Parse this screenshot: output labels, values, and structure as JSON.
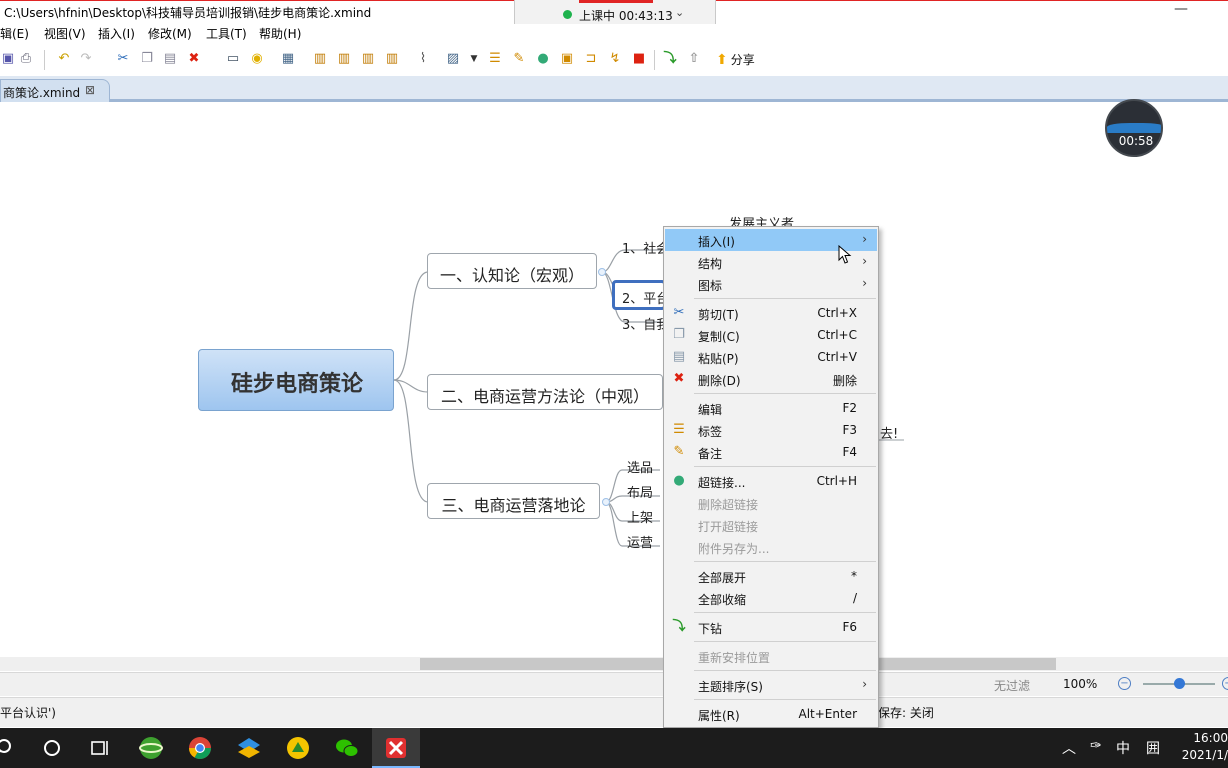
{
  "window": {
    "path": "C:\\Users\\hfnin\\Desktop\\科技辅导员培训报销\\硅步电商策论.xmind",
    "minimize_glyph": "—"
  },
  "class_timer": {
    "label": "上课中 00:43:13",
    "chevron": "⌄"
  },
  "menubar": {
    "items": [
      "辑(E)",
      "视图(V)",
      "插入(I)",
      "修改(M)",
      "工具(T)",
      "帮助(H)"
    ]
  },
  "toolbar": {
    "share_label": "分享"
  },
  "tab": {
    "label": "商策论.xmind",
    "close": "⊠"
  },
  "recording_timer": "00:58",
  "mindmap": {
    "central": "硅步电商策论",
    "topics": [
      "一、认知论（宏观）",
      "二、电商运营方法论（中观）",
      "三、电商运营落地论"
    ],
    "subtopics_1": [
      "1、社会",
      "2、平台",
      "3、自我"
    ],
    "subtopics_3": [
      "选品",
      "布局",
      "上架",
      "运营"
    ],
    "float_text_1": "发展主义者",
    "float_text_2": "去!"
  },
  "context_menu": {
    "items": [
      {
        "label": "插入(I)",
        "shortcut": "",
        "submenu": true,
        "icon": "",
        "active": true,
        "disabled": false
      },
      {
        "label": "结构",
        "shortcut": "",
        "submenu": true,
        "icon": "",
        "active": false,
        "disabled": false
      },
      {
        "label": "图标",
        "shortcut": "",
        "submenu": true,
        "icon": "",
        "active": false,
        "disabled": false
      },
      {
        "label": "剪切(T)",
        "shortcut": "Ctrl+X",
        "submenu": false,
        "icon": "scissors-icon",
        "active": false,
        "disabled": false
      },
      {
        "label": "复制(C)",
        "shortcut": "Ctrl+C",
        "submenu": false,
        "icon": "copy-icon",
        "active": false,
        "disabled": false
      },
      {
        "label": "粘贴(P)",
        "shortcut": "Ctrl+V",
        "submenu": false,
        "icon": "paste-icon",
        "active": false,
        "disabled": false
      },
      {
        "label": "删除(D)",
        "shortcut": "删除",
        "submenu": false,
        "icon": "delete-icon",
        "active": false,
        "disabled": false
      },
      {
        "label": "编辑",
        "shortcut": "F2",
        "submenu": false,
        "icon": "",
        "active": false,
        "disabled": false
      },
      {
        "label": "标签",
        "shortcut": "F3",
        "submenu": false,
        "icon": "label-icon",
        "active": false,
        "disabled": false
      },
      {
        "label": "备注",
        "shortcut": "F4",
        "submenu": false,
        "icon": "note-icon",
        "active": false,
        "disabled": false
      },
      {
        "label": "超链接...",
        "shortcut": "Ctrl+H",
        "submenu": false,
        "icon": "globe-icon",
        "active": false,
        "disabled": false
      },
      {
        "label": "删除超链接",
        "shortcut": "",
        "submenu": false,
        "icon": "",
        "active": false,
        "disabled": true
      },
      {
        "label": "打开超链接",
        "shortcut": "",
        "submenu": false,
        "icon": "",
        "active": false,
        "disabled": true
      },
      {
        "label": "附件另存为...",
        "shortcut": "",
        "submenu": false,
        "icon": "",
        "active": false,
        "disabled": true
      },
      {
        "label": "全部展开",
        "shortcut": "*",
        "submenu": false,
        "icon": "",
        "active": false,
        "disabled": false
      },
      {
        "label": "全部收缩",
        "shortcut": "/",
        "submenu": false,
        "icon": "",
        "active": false,
        "disabled": false
      },
      {
        "label": "下钻",
        "shortcut": "F6",
        "submenu": false,
        "icon": "drill-down-icon",
        "active": false,
        "disabled": false
      },
      {
        "label": "重新安排位置",
        "shortcut": "",
        "submenu": false,
        "icon": "",
        "active": false,
        "disabled": true
      },
      {
        "label": "主题排序(S)",
        "shortcut": "",
        "submenu": true,
        "icon": "",
        "active": false,
        "disabled": false
      },
      {
        "label": "属性(R)",
        "shortcut": "Alt+Enter",
        "submenu": false,
        "icon": "",
        "active": false,
        "disabled": false
      }
    ]
  },
  "status": {
    "filter": "无过滤",
    "zoom": "100%",
    "zoom_minus": "−",
    "zoom_plus": "+",
    "left_text": "平台认识')",
    "autosave": "保存: 关闭"
  },
  "taskbar": {
    "clock_time": "16:00",
    "clock_date": "2021/1/",
    "ime": "中",
    "grid_glyph": "囲"
  }
}
